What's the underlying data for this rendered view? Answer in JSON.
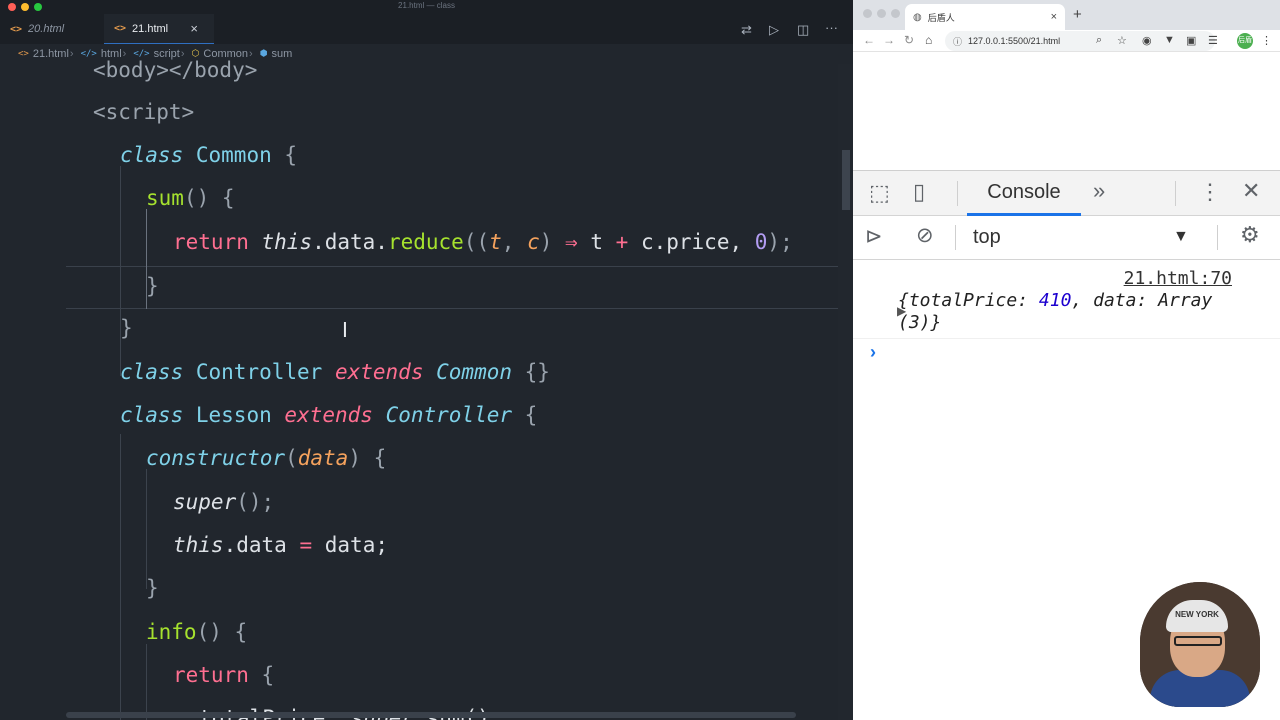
{
  "window": {
    "title": "21.html — class"
  },
  "editor": {
    "tabs": [
      {
        "label": "20.html"
      },
      {
        "label": "21.html"
      }
    ],
    "breadcrumb": [
      "21.html",
      "html",
      "script",
      "Common",
      "sum"
    ],
    "code": {
      "l1": [
        "<body></body>"
      ],
      "l2": [
        "<script>"
      ],
      "l3": [
        "class",
        "Common",
        "{"
      ],
      "l4": [
        "sum",
        "()",
        "{"
      ],
      "l5": [
        "return",
        "this",
        ".data.",
        "reduce",
        "((",
        "t",
        ", ",
        "c",
        ")",
        "⇒",
        "t",
        "+",
        "c.price, ",
        "0",
        ");"
      ],
      "l6": [
        "}"
      ],
      "l7": [
        "}"
      ],
      "l8": [
        "class",
        "Controller",
        "extends",
        "Common",
        "{}"
      ],
      "l9": [
        "class",
        "Lesson",
        "extends",
        "Controller",
        "{"
      ],
      "l10": [
        "constructor",
        "(",
        "data",
        ") {"
      ],
      "l11": [
        "super",
        "();"
      ],
      "l12": [
        "this",
        ".data",
        "=",
        "data;"
      ],
      "l13": [
        "}"
      ],
      "l14": [
        "info",
        "()",
        "{"
      ],
      "l15": [
        "return",
        "{"
      ],
      "l16": [
        "totalPrice:",
        "super",
        ".sum()"
      ]
    }
  },
  "browser": {
    "tab_title": "后盾人",
    "url": "127.0.0.1:5500/21.html",
    "avatar": "后盾",
    "devtools": {
      "console_tab": "Console",
      "context": "top",
      "log": {
        "source": "21.html:70",
        "open": "{",
        "key1": "totalPrice",
        "val1": "410",
        "key2": "data",
        "val2": "Array",
        "len": "(3)}"
      }
    }
  },
  "webcam": {
    "cap_text": "NEW YORK"
  }
}
